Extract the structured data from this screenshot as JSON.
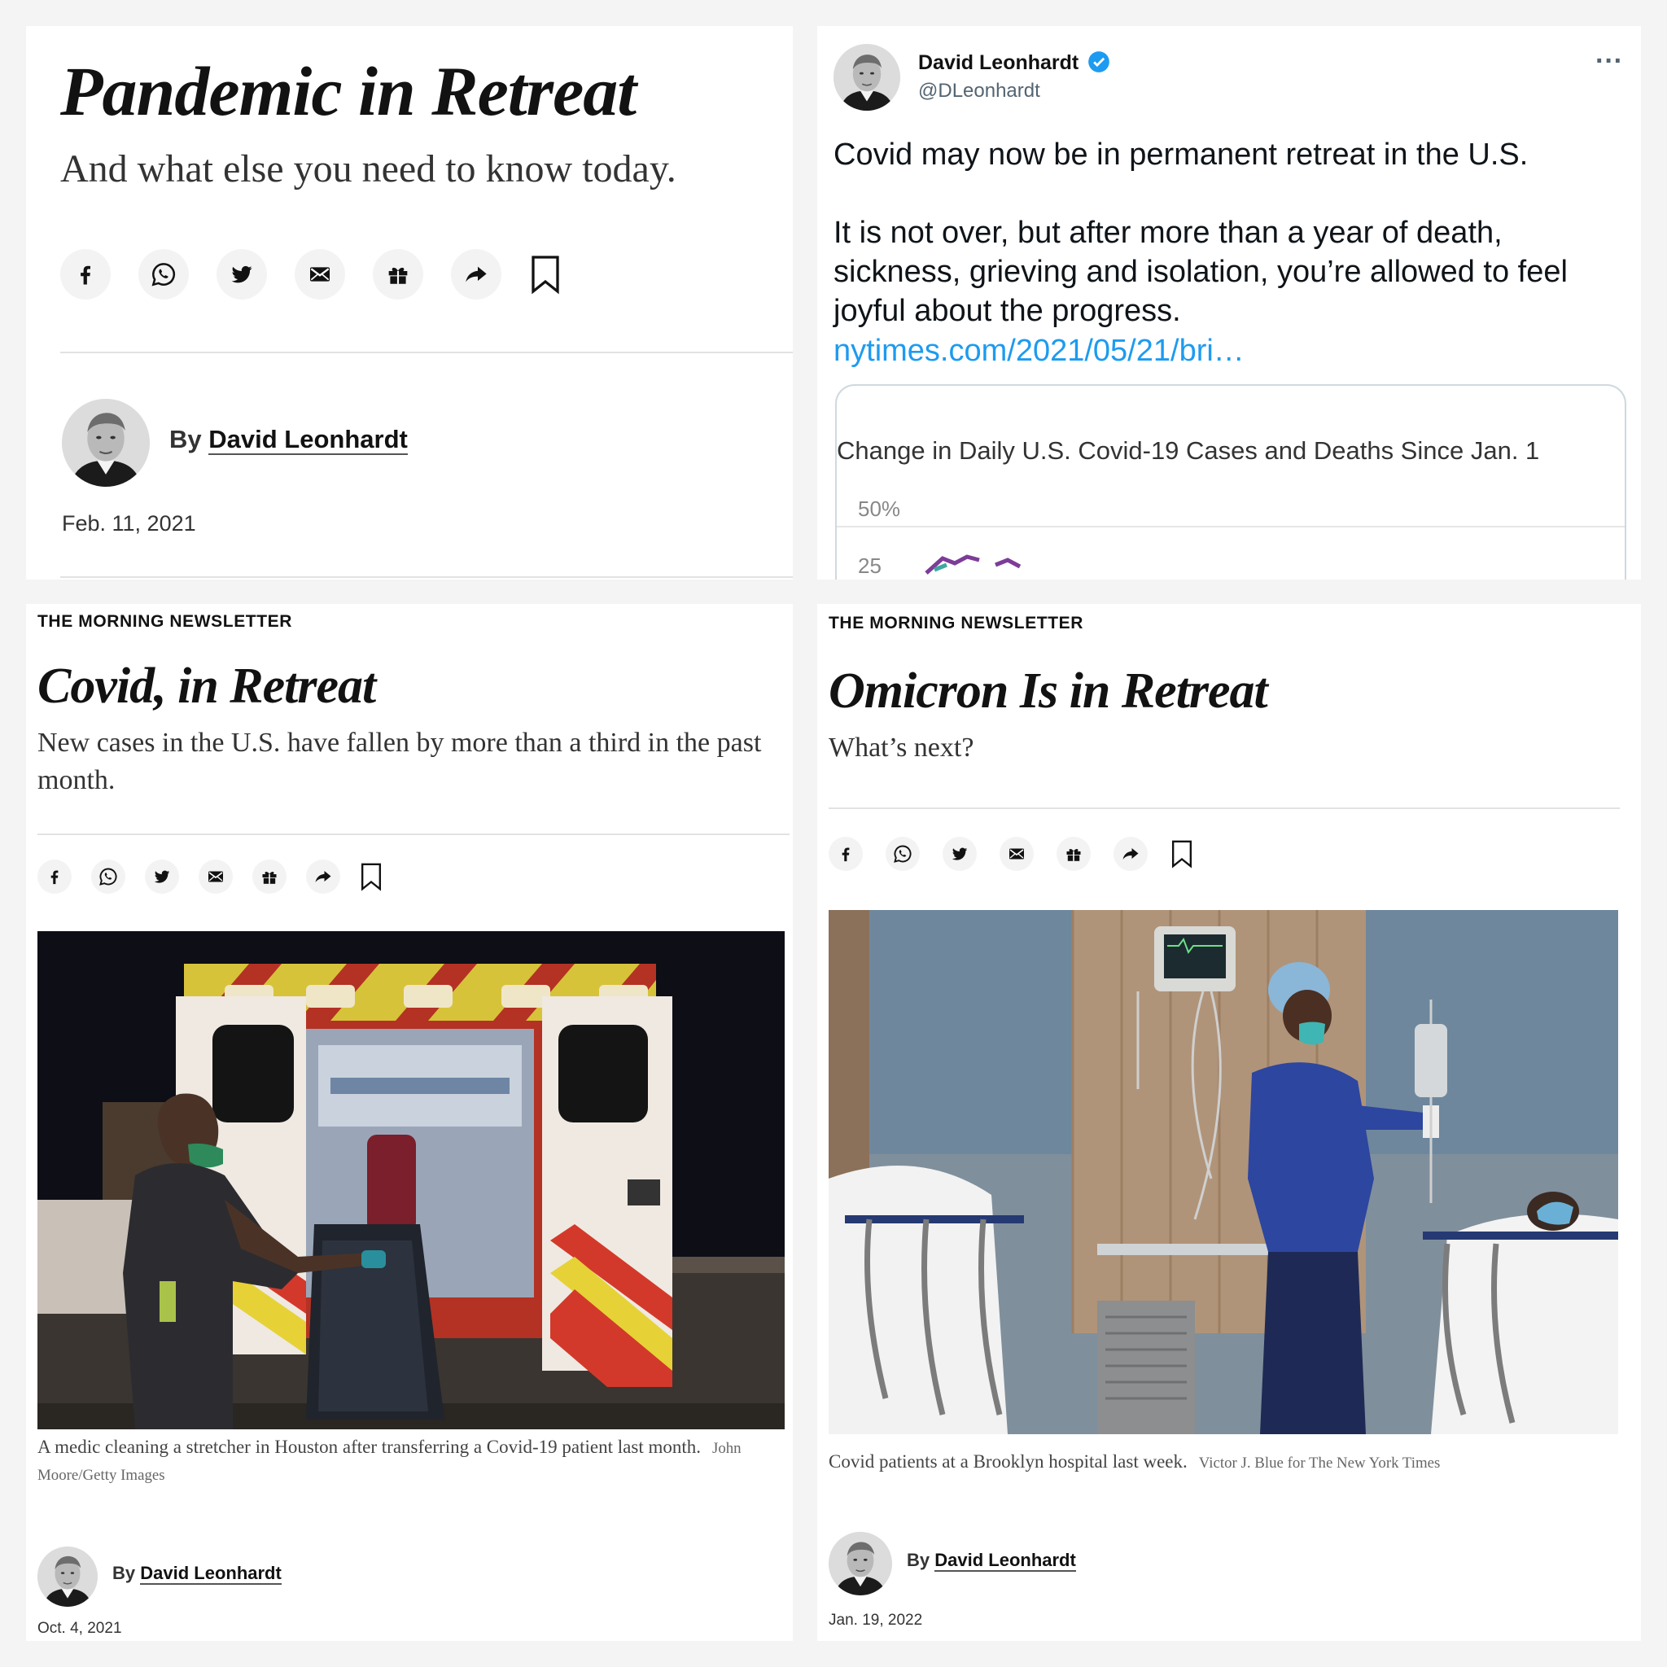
{
  "share_icons": [
    "facebook-icon",
    "whatsapp-icon",
    "twitter-icon",
    "email-icon",
    "gift-icon",
    "share-arrow-icon"
  ],
  "panel_tl": {
    "headline": "Pandemic in Retreat",
    "dek": "And what else you need to know today.",
    "byline_prefix": "By ",
    "author": "David Leonhardt",
    "date": "Feb. 11, 2021"
  },
  "tweet": {
    "display_name": "David Leonhardt",
    "handle": "@DLeonhardt",
    "verified": true,
    "more_glyph": "···",
    "line1": "Covid may now be in permanent retreat in the U.S.",
    "line2": "It is not over, but after more than a year of death, sickness, grieving and isolation, you’re allowed to feel joyful about the progress.",
    "link": "nytimes.com/2021/05/21/bri…",
    "card": {
      "chart_title": "Change in Daily U.S. Covid-19 Cases and Deaths Since Jan. 1",
      "tick_top": "50%",
      "tick_cut": "25"
    },
    "link_color": "#1d9bf0"
  },
  "panel_bl": {
    "kicker": "THE MORNING NEWSLETTER",
    "headline": "Covid, in Retreat",
    "dek": "New cases in the U.S. have fallen by more than a third in the past month.",
    "caption": "A medic cleaning a stretcher in Houston after transferring a Covid-19 patient last month.",
    "credit": "John Moore/Getty Images",
    "byline_prefix": "By ",
    "author": "David Leonhardt",
    "date": "Oct. 4, 2021"
  },
  "panel_br": {
    "kicker": "THE MORNING NEWSLETTER",
    "headline": "Omicron Is in Retreat",
    "dek": "What’s next?",
    "caption": "Covid patients at a Brooklyn hospital last week.",
    "credit": "Victor J. Blue for The New York Times",
    "byline_prefix": "By ",
    "author": "David Leonhardt",
    "date": "Jan. 19, 2022"
  }
}
